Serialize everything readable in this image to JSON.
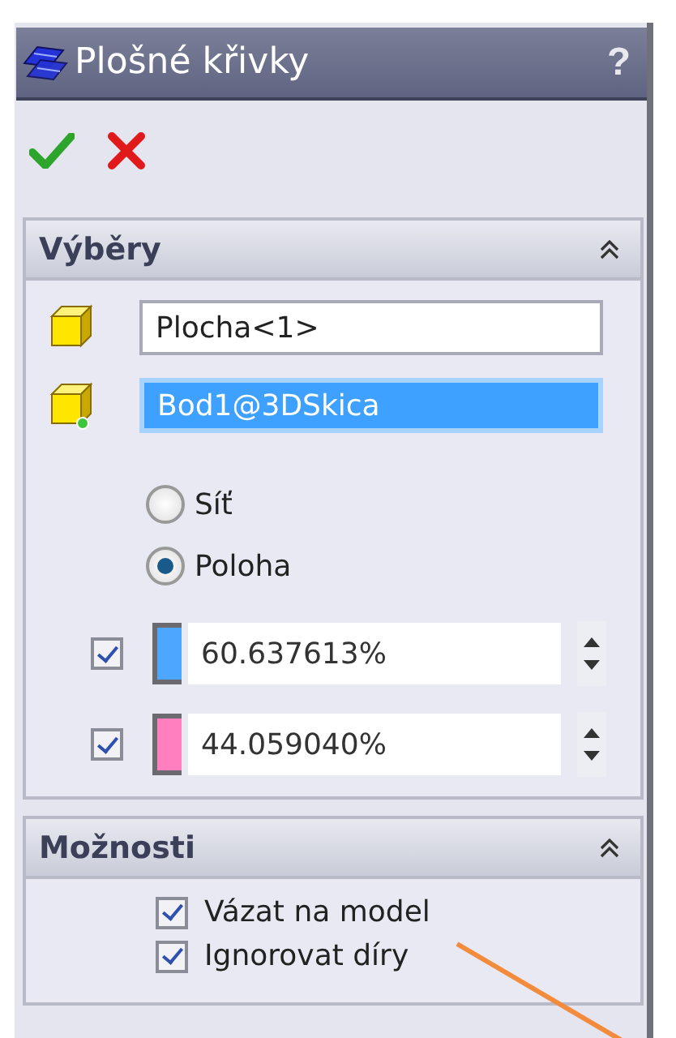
{
  "window": {
    "title": "Plošné křivky",
    "help": "?"
  },
  "sections": [
    {
      "title": "Výběry",
      "expanded": true,
      "fields": [
        {
          "kind": "face",
          "value": "Plocha<1>",
          "selected": false
        },
        {
          "kind": "point",
          "value": "Bod1@3DSkica",
          "selected": true
        }
      ],
      "radios": [
        {
          "label": "Síť",
          "selected": false
        },
        {
          "label": "Poloha",
          "selected": true
        }
      ],
      "params": [
        {
          "checked": true,
          "color": "#4da6ff",
          "value": "60.637613%"
        },
        {
          "checked": true,
          "color": "#ff7fbf",
          "value": "44.059040%"
        }
      ]
    },
    {
      "title": "Možnosti",
      "expanded": true,
      "options": [
        {
          "label": "Vázat na model",
          "checked": true
        },
        {
          "label": "Ignorovat díry",
          "checked": true
        }
      ]
    }
  ]
}
